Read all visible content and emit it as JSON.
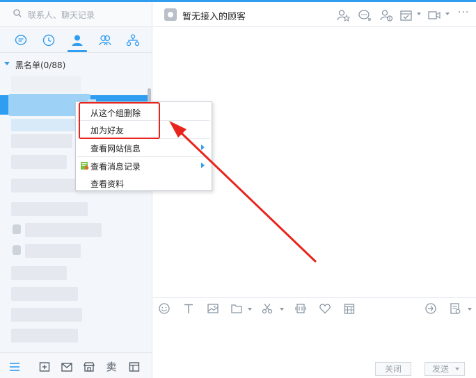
{
  "search": {
    "placeholder": "联系人、聊天记录"
  },
  "nav_tabs": [
    {
      "name": "recent-sessions",
      "icon": "chat-bubble-icon"
    },
    {
      "name": "history",
      "icon": "clock-icon"
    },
    {
      "name": "contacts",
      "icon": "person-icon",
      "active": true
    },
    {
      "name": "groups",
      "icon": "group-icon"
    },
    {
      "name": "organization",
      "icon": "org-chart-icon"
    }
  ],
  "contact_group": {
    "label": "黑名单(0/88)",
    "expanded": true
  },
  "context_menu": {
    "items": [
      {
        "label": "从这个组删除",
        "has_submenu": false
      },
      {
        "label": "加为好友",
        "has_submenu": false
      },
      {
        "label": "查看网站信息",
        "has_submenu": true
      },
      {
        "label": "查看消息记录",
        "has_submenu": true,
        "icon": "chat-history-icon"
      },
      {
        "label": "查看资料",
        "has_submenu": false
      }
    ]
  },
  "chat": {
    "title": "暂无接入的顾客"
  },
  "header_icons": [
    "invite-icon",
    "transfer-chat-icon",
    "customer-icon",
    "schedule-icon",
    "video-icon"
  ],
  "toolbar_icons": [
    "emoji-icon",
    "font-icon",
    "image-icon",
    "folder-icon",
    "screenshot-icon",
    "sound-icon",
    "favorite-icon",
    "calendar-icon"
  ],
  "toolbar_right_icons": [
    "quick-reply-icon",
    "template-icon"
  ],
  "bottom_bar": {
    "icons": [
      "menu-icon",
      "plus-window-icon",
      "mail-icon",
      "shop-icon",
      "sell-icon",
      "layout-icon"
    ],
    "sell_label": "卖"
  },
  "buttons": {
    "close_label": "关闭",
    "send_label": "发送"
  },
  "colors": {
    "accent": "#2f9df0",
    "annotation_red": "#e8251c"
  }
}
